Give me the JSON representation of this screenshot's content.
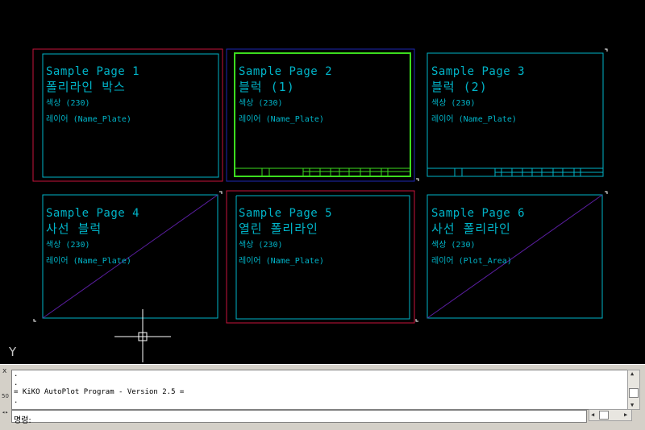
{
  "pages": [
    {
      "title": "Sample Page 1",
      "subtitle": "폴리라인 박스",
      "color": "색상 (230)",
      "layer": "레이어 (Name_Plate)"
    },
    {
      "title": "Sample Page 2",
      "subtitle": "블럭 (1)",
      "color": "색상 (230)",
      "layer": "레이어 (Name_Plate)"
    },
    {
      "title": "Sample Page 3",
      "subtitle": "블럭 (2)",
      "color": "색상 (230)",
      "layer": "레이어 (Name_Plate)"
    },
    {
      "title": "Sample Page 4",
      "subtitle": "사선 블럭",
      "color": "색상 (230)",
      "layer": "레이어 (Name_Plate)"
    },
    {
      "title": "Sample Page 5",
      "subtitle": "열린 폴리라인",
      "color": "색상 (230)",
      "layer": "레이어 (Name_Plate)"
    },
    {
      "title": "Sample Page 6",
      "subtitle": "사선 폴리라인",
      "color": "색상 (230)",
      "layer": "레이어 (Plot_Area)"
    }
  ],
  "canvas": {
    "y_axis_label": "Y"
  },
  "command": {
    "history": [
      ".",
      ".",
      "= KiKO AutoPlot Program - Version 2.5 =",
      "."
    ],
    "prompt": "명령:",
    "panel_close": "x",
    "panel_number": "50"
  },
  "colors": {
    "cyan": "#00b4c8",
    "red": "#c8143c",
    "green": "#3cdc1e",
    "blue": "#1e28b4"
  }
}
